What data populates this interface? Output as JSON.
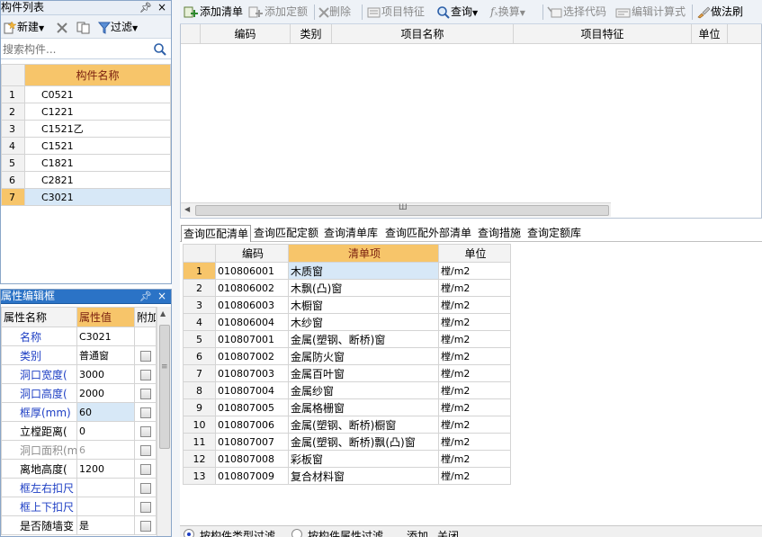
{
  "component_panel": {
    "title": "构件列表",
    "pin": "ᵖ",
    "close": "×",
    "toolbar": {
      "new_label": "新建",
      "filter_label": "过滤"
    },
    "search": {
      "placeholder": "搜索构件..."
    },
    "table": {
      "header": "构件名称",
      "rows": [
        {
          "num": "1",
          "name": "C0521"
        },
        {
          "num": "2",
          "name": "C1221"
        },
        {
          "num": "3",
          "name": "C1521乙"
        },
        {
          "num": "4",
          "name": "C1521"
        },
        {
          "num": "5",
          "name": "C1821"
        },
        {
          "num": "6",
          "name": "C2821"
        },
        {
          "num": "7",
          "name": "C3021"
        }
      ],
      "selected_row": 7
    }
  },
  "property_panel": {
    "title": "属性编辑框",
    "headers": {
      "name": "属性名称",
      "value": "属性值",
      "extra": "附加"
    },
    "rows": [
      {
        "name": "名称",
        "value": "C3021",
        "has_checkbox": false
      },
      {
        "name": "类别",
        "value": "普通窗",
        "has_checkbox": true
      },
      {
        "name": "洞口宽度(",
        "value": "3000",
        "has_checkbox": true
      },
      {
        "name": "洞口高度(",
        "value": "2000",
        "has_checkbox": true
      },
      {
        "name": "框厚(mm)",
        "value": "60",
        "has_checkbox": true
      },
      {
        "name": "立樘距离(",
        "value": "0",
        "has_checkbox": true
      },
      {
        "name": "洞口面积(m",
        "value": "6",
        "has_checkbox": true
      },
      {
        "name": "离地高度(",
        "value": "1200",
        "has_checkbox": true
      },
      {
        "name": "框左右扣尺",
        "value": "",
        "has_checkbox": true
      },
      {
        "name": "框上下扣尺",
        "value": "",
        "has_checkbox": true
      },
      {
        "name": "是否随墙变",
        "value": "是",
        "has_checkbox": true
      }
    ]
  },
  "main_toolbar": {
    "add_list": "添加清单",
    "add_quota": "添加定额",
    "delete": "删除",
    "item_feature": "项目特征",
    "query": "查询",
    "convert": "换算",
    "select_code": "选择代码",
    "edit_formula": "编辑计算式",
    "method_brush": "做法刷"
  },
  "upper_grid": {
    "columns": [
      "编码",
      "类别",
      "项目名称",
      "项目特征",
      "单位"
    ],
    "scroll_grip": "Ш"
  },
  "query_tabs": [
    "查询匹配清单",
    "查询匹配定额",
    "查询清单库",
    "查询匹配外部清单",
    "查询措施",
    "查询定额库"
  ],
  "lower_grid": {
    "columns": [
      "编码",
      "清单项",
      "单位"
    ],
    "rows": [
      {
        "num": "1",
        "code": "010806001",
        "item": "木质窗",
        "unit": "樘/m2"
      },
      {
        "num": "2",
        "code": "010806002",
        "item": "木飘(凸)窗",
        "unit": "樘/m2"
      },
      {
        "num": "3",
        "code": "010806003",
        "item": "木橱窗",
        "unit": "樘/m2"
      },
      {
        "num": "4",
        "code": "010806004",
        "item": "木纱窗",
        "unit": "樘/m2"
      },
      {
        "num": "5",
        "code": "010807001",
        "item": "金属(塑钢、断桥)窗",
        "unit": "樘/m2"
      },
      {
        "num": "6",
        "code": "010807002",
        "item": "金属防火窗",
        "unit": "樘/m2"
      },
      {
        "num": "7",
        "code": "010807003",
        "item": "金属百叶窗",
        "unit": "樘/m2"
      },
      {
        "num": "8",
        "code": "010807004",
        "item": "金属纱窗",
        "unit": "樘/m2"
      },
      {
        "num": "9",
        "code": "010807005",
        "item": "金属格栅窗",
        "unit": "樘/m2"
      },
      {
        "num": "10",
        "code": "010807006",
        "item": "金属(塑钢、断桥)橱窗",
        "unit": "樘/m2"
      },
      {
        "num": "11",
        "code": "010807007",
        "item": "金属(塑钢、断桥)飘(凸)窗",
        "unit": "樘/m2"
      },
      {
        "num": "12",
        "code": "010807008",
        "item": "彩板窗",
        "unit": "樘/m2"
      },
      {
        "num": "13",
        "code": "010807009",
        "item": "复合材料窗",
        "unit": "樘/m2"
      }
    ],
    "selected_row": 1
  },
  "filter_bar": {
    "by_type": "按构件类型过滤",
    "by_attr": "按构件属性过滤",
    "add": "添加",
    "close": "关闭"
  }
}
